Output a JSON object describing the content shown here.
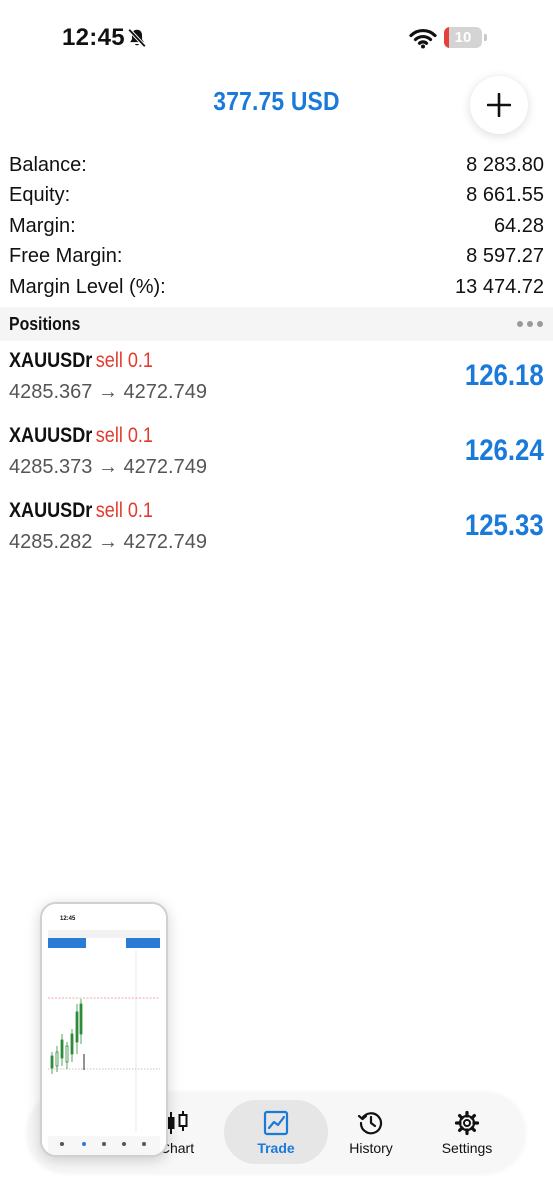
{
  "status_bar": {
    "time": "12:45",
    "battery_level": "10",
    "battery_fraction": 0.1,
    "icons": [
      "bell-slash-icon",
      "wifi-icon",
      "battery-icon"
    ]
  },
  "header": {
    "amount": "377.75 USD",
    "add_icon": "plus-icon"
  },
  "summary": [
    {
      "label": "Balance:",
      "value": "8 283.80"
    },
    {
      "label": "Equity:",
      "value": "8 661.55"
    },
    {
      "label": "Margin:",
      "value": "64.28"
    },
    {
      "label": "Free Margin:",
      "value": "8 597.27"
    },
    {
      "label": "Margin Level (%):",
      "value": "13 474.72"
    }
  ],
  "positions": {
    "title": "Positions",
    "more_icon": "more-horizontal-icon",
    "items": [
      {
        "symbol": "XAUUSDr",
        "side": "sell 0.1",
        "prices": "4285.367 → 4272.749",
        "profit": "126.18"
      },
      {
        "symbol": "XAUUSDr",
        "side": "sell 0.1",
        "prices": "4285.373 → 4272.749",
        "profit": "126.24"
      },
      {
        "symbol": "XAUUSDr",
        "side": "sell 0.1",
        "prices": "4285.282 → 4272.749",
        "profit": "125.33"
      }
    ]
  },
  "nav": {
    "items": [
      {
        "label": "Chart",
        "icon": "candlestick-icon"
      },
      {
        "label": "Trade",
        "icon": "trend-chart-icon",
        "active": true
      },
      {
        "label": "History",
        "icon": "history-icon"
      },
      {
        "label": "Settings",
        "icon": "gear-icon"
      }
    ]
  },
  "thumbnail": {
    "time": "12:45"
  },
  "colors": {
    "accent": "#1a7ad9",
    "sell": "#e23a2e",
    "text": "#111111",
    "muted": "#555555",
    "section_bg": "#f5f5f5"
  }
}
